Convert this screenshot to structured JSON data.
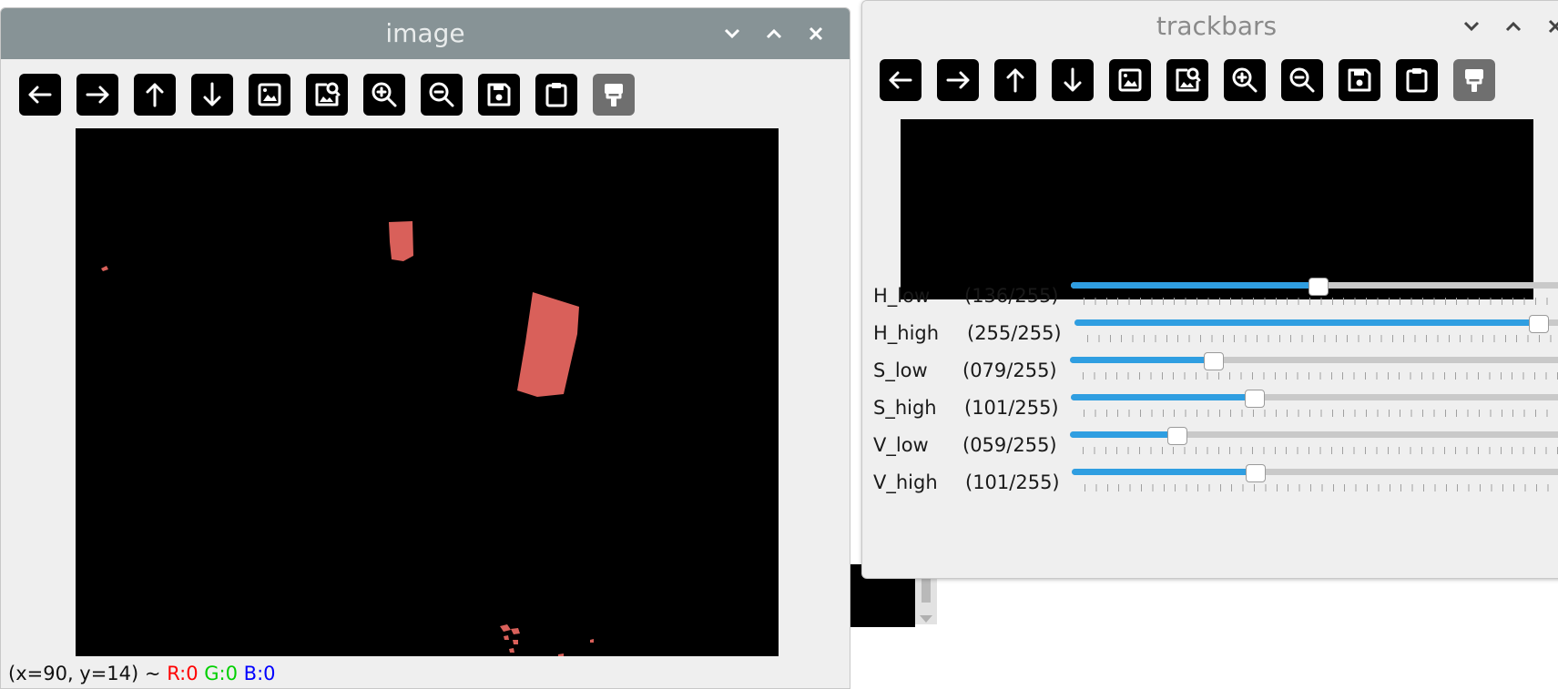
{
  "image_window": {
    "title": "image",
    "controls": [
      "chevron-down",
      "chevron-up",
      "close"
    ],
    "toolbar": [
      {
        "name": "arrow-left-icon",
        "glyph": "←",
        "enabled": true
      },
      {
        "name": "arrow-right-icon",
        "glyph": "→",
        "enabled": true
      },
      {
        "name": "arrow-up-icon",
        "glyph": "↑",
        "enabled": true
      },
      {
        "name": "arrow-down-icon",
        "glyph": "↓",
        "enabled": true
      },
      {
        "name": "image-icon",
        "glyph": "img",
        "enabled": true
      },
      {
        "name": "image-search-icon",
        "glyph": "imgsearch",
        "enabled": true
      },
      {
        "name": "zoom-in-icon",
        "glyph": "+",
        "enabled": true
      },
      {
        "name": "zoom-out-icon",
        "glyph": "-",
        "enabled": true
      },
      {
        "name": "save-icon",
        "glyph": "save",
        "enabled": true
      },
      {
        "name": "clipboard-icon",
        "glyph": "clip",
        "enabled": true
      },
      {
        "name": "paint-brush-icon",
        "glyph": "brush",
        "enabled": false
      }
    ],
    "status": {
      "coords": "(x=90, y=14) ~ ",
      "r": "R:0",
      "g": "G:0",
      "b": "B:0"
    },
    "blob_color": "#d9605a"
  },
  "trackbar_window": {
    "title": "trackbars",
    "controls": [
      "chevron-down",
      "chevron-up",
      "close"
    ],
    "trackbars": [
      {
        "name": "H_low",
        "value_text": "(136/255)",
        "value": 136,
        "max": 255
      },
      {
        "name": "H_high",
        "value_text": "(255/255)",
        "value": 255,
        "max": 255
      },
      {
        "name": "S_low",
        "value_text": "(079/255)",
        "value": 79,
        "max": 255
      },
      {
        "name": "S_high",
        "value_text": "(101/255)",
        "value": 101,
        "max": 255
      },
      {
        "name": "V_low",
        "value_text": "(059/255)",
        "value": 59,
        "max": 255
      },
      {
        "name": "V_high",
        "value_text": "(101/255)",
        "value": 101,
        "max": 255
      }
    ]
  },
  "colors": {
    "slider_fill": "#2f9ee1",
    "titlebar_active": "#879396"
  }
}
